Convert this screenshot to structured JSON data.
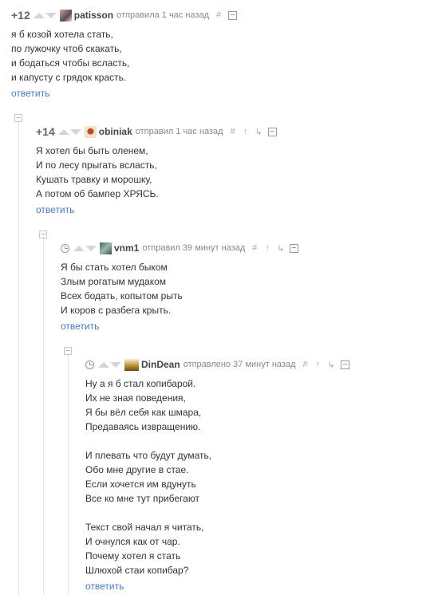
{
  "comments": [
    {
      "rating": "+12",
      "username": "patisson",
      "action": "отправила 1 час назад",
      "lines": [
        "я б козой хотела стать,",
        "по лужочку чтоб скакать,",
        "и бодаться чтобы всласть,",
        "и капусту с грядок красть."
      ],
      "reply": "ответить"
    },
    {
      "rating": "+14",
      "username": "obiniak",
      "action": "отправил 1 час назад",
      "lines": [
        "Я хотел бы быть оленем,",
        "И по лесу прыгать всласть,",
        "Кушать травку и морошку,",
        "А потом об бампер ХРЯСЬ."
      ],
      "reply": "ответить"
    },
    {
      "rating": "",
      "username": "vnm1",
      "action": "отправил 39 минут назад",
      "lines": [
        "Я бы стать хотел быком",
        "Злым рогатым мудаком",
        "Всех бодать, копытом рыть",
        "И коров с разбега крыть."
      ],
      "reply": "ответить"
    },
    {
      "rating": "",
      "username": "DinDean",
      "action": "отправлено 37 минут назад",
      "lines": [
        "Ну а я б стал копибарой.",
        "Их не зная поведения,",
        "Я бы вёл себя как шмара,",
        "Предаваясь извращению.",
        "",
        "И плевать что будут думать,",
        "Обо мне другие в стае.",
        "Если хочется им вдунуть",
        "Все ко мне тут прибегают",
        "",
        "Текст свой начал я читать,",
        "И очнулся как от чар.",
        "Почему хотел я стать",
        "Шлюхой стаи копибар?"
      ],
      "reply": "ответить"
    }
  ],
  "icons": {
    "link": "#",
    "tree": "↑",
    "branch": "↳"
  }
}
